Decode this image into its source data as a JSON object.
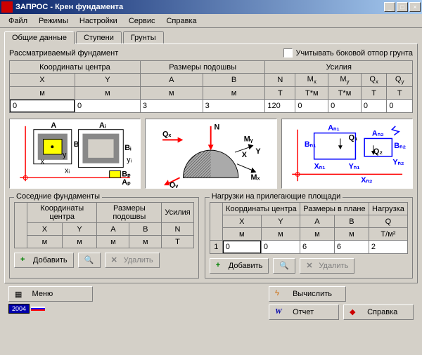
{
  "window": {
    "title": "ЗАПРОС - Крен фундамента"
  },
  "menu": [
    "Файл",
    "Режимы",
    "Настройки",
    "Сервис",
    "Справка"
  ],
  "tabs": {
    "items": [
      "Общие данные",
      "Ступени",
      "Грунты"
    ],
    "active": 0
  },
  "panel": {
    "heading": "Рассматриваемый фундамент",
    "checkbox_label": "Учитывать боковой отпор грунта",
    "group1": {
      "title": "Координаты центра",
      "cols": [
        "X",
        "Y"
      ],
      "units": [
        "м",
        "м"
      ],
      "values": [
        "0",
        "0"
      ]
    },
    "group2": {
      "title": "Размеры подошвы",
      "cols": [
        "A",
        "B"
      ],
      "units": [
        "м",
        "м"
      ],
      "values": [
        "3",
        "3"
      ]
    },
    "group3": {
      "title": "Усилия",
      "cols": [
        "N",
        "Mx",
        "My",
        "Qx",
        "Qy"
      ],
      "units": [
        "Т",
        "Т*м",
        "Т*м",
        "Т",
        "Т"
      ],
      "values": [
        "120",
        "0",
        "0",
        "0",
        "0"
      ]
    }
  },
  "neighbors": {
    "title": "Соседние фундаменты",
    "group_titles": [
      "Координаты центра",
      "Размеры подошвы",
      "Усилия"
    ],
    "cols": [
      "X",
      "Y",
      "A",
      "B",
      "N"
    ],
    "units": [
      "м",
      "м",
      "м",
      "м",
      "Т"
    ]
  },
  "loads": {
    "title": "Нагрузки на прилегающие площади",
    "group_titles": [
      "Координаты центра",
      "Размеры в плане",
      "Нагрузка"
    ],
    "cols": [
      "X",
      "Y",
      "A",
      "B",
      "Q"
    ],
    "units": [
      "м",
      "м",
      "м",
      "м",
      "Т/м²"
    ],
    "row_num": "1",
    "values": [
      "0",
      "0",
      "6",
      "6",
      "2"
    ]
  },
  "buttons": {
    "add": "Добавить",
    "delete": "Удалить",
    "menu": "Меню",
    "compute": "Вычислить",
    "report": "Отчет",
    "help": "Справка"
  },
  "badge": "2004"
}
